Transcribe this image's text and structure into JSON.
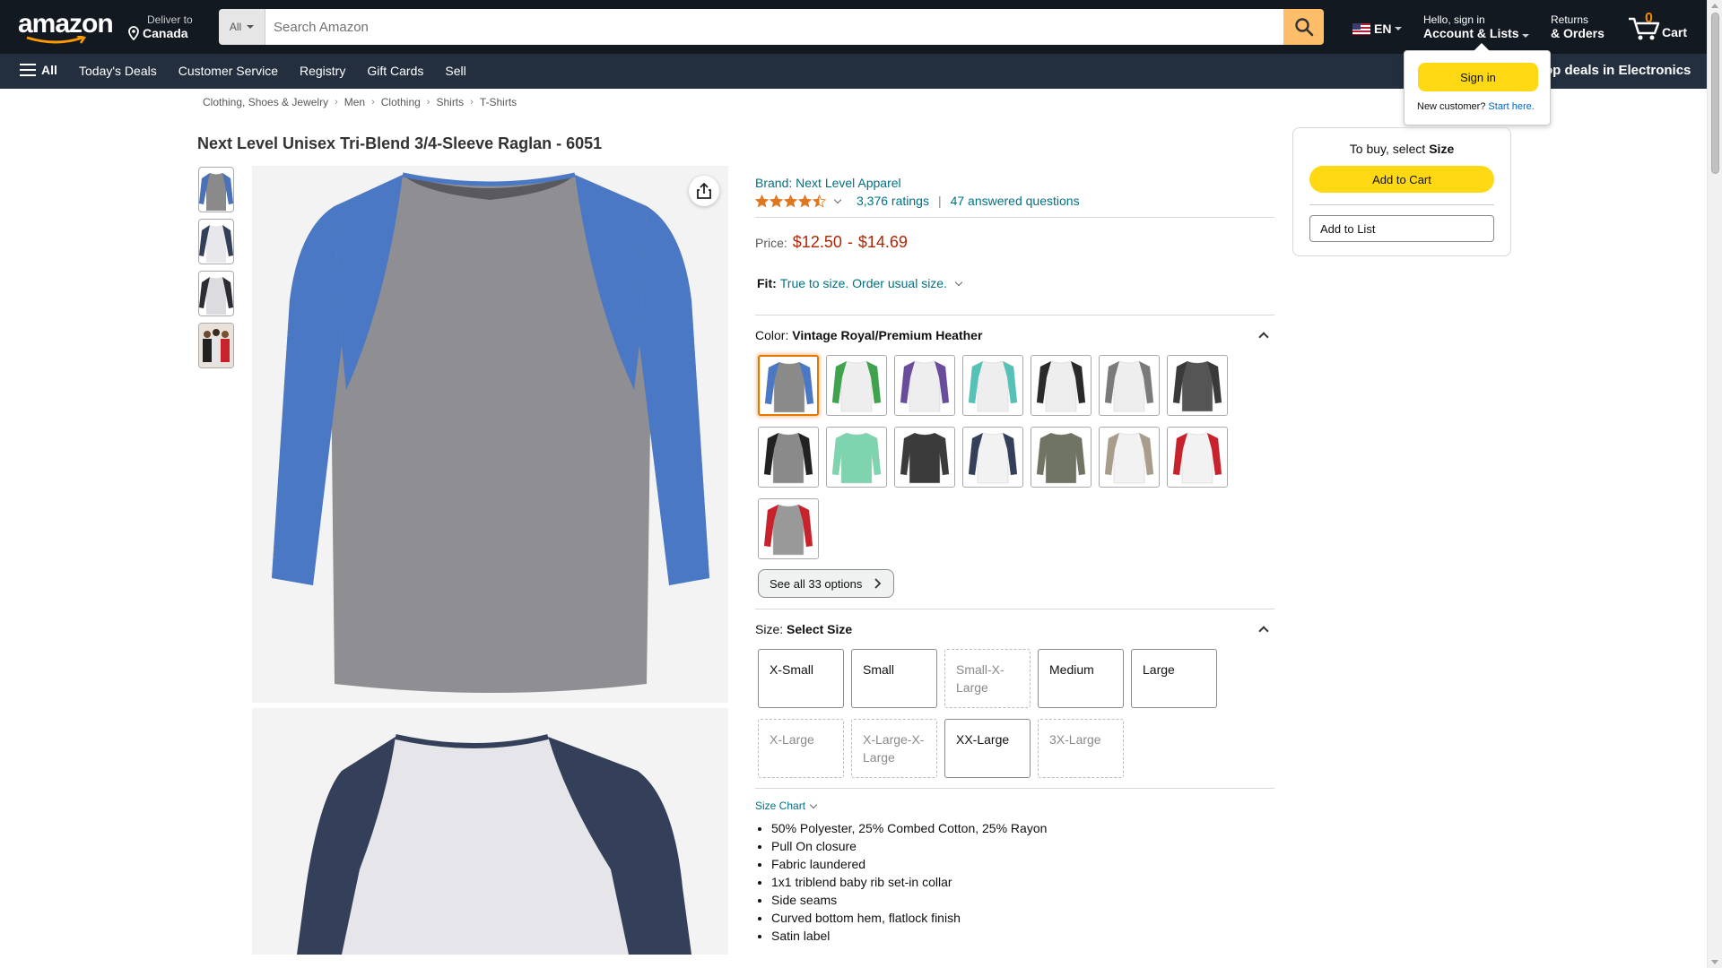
{
  "header": {
    "deliver_line1": "Deliver to",
    "deliver_line2": "Canada",
    "search_category": "All",
    "search_placeholder": "Search Amazon",
    "language": "EN",
    "account_line1": "Hello, sign in",
    "account_line2": "Account & Lists",
    "returns_line1": "Returns",
    "returns_line2": "& Orders",
    "cart_count": "0",
    "cart_label": "Cart"
  },
  "subnav": {
    "all_label": "All",
    "links": [
      "Today's Deals",
      "Customer Service",
      "Registry",
      "Gift Cards",
      "Sell"
    ],
    "promo": "op deals in Electronics"
  },
  "signin_flyout": {
    "button": "Sign in",
    "new_customer": "New customer?",
    "start_here": "Start here."
  },
  "breadcrumb": [
    "Clothing, Shoes & Jewelry",
    "Men",
    "Clothing",
    "Shirts",
    "T-Shirts"
  ],
  "product": {
    "title": "Next Level Unisex Tri-Blend 3/4-Sleeve Raglan - 6051",
    "brand": "Brand: Next Level Apparel",
    "rating_value": 4.5,
    "ratings_count": "3,376 ratings",
    "answered": "47 answered questions",
    "price_label": "Price:",
    "price_low": "$12.50",
    "price_sep": "-",
    "price_high": "$14.69",
    "fit_label": "Fit:",
    "fit_value": "True to size. Order usual size.",
    "color_label": "Color:",
    "color_value": "Vintage Royal/Premium Heather",
    "see_all": "See all 33 options",
    "size_label": "Size:",
    "size_value": "Select Size",
    "sizes": [
      {
        "label": "X-Small",
        "available": true
      },
      {
        "label": "Small",
        "available": true
      },
      {
        "label": "Small-X-Large",
        "available": false
      },
      {
        "label": "Medium",
        "available": true
      },
      {
        "label": "Large",
        "available": true
      },
      {
        "label": "X-Large",
        "available": false
      },
      {
        "label": "X-Large-X-Large",
        "available": false
      },
      {
        "label": "XX-Large",
        "available": true
      },
      {
        "label": "3X-Large",
        "available": false
      }
    ],
    "size_chart": "Size Chart",
    "bullets": [
      "50% Polyester, 25% Combed Cotton, 25% Rayon",
      "Pull On closure",
      "Fabric laundered",
      "1x1 triblend baby rib set-in collar",
      "Side seams",
      "Curved bottom hem, flatlock finish",
      "Satin label"
    ]
  },
  "buybox": {
    "prompt": "To buy, select",
    "prompt_bold": "Size",
    "add_to_cart": "Add to Cart",
    "add_to_list": "Add to List"
  },
  "colors": {
    "nav_dark": "#131921",
    "nav_sub": "#232f3e",
    "search_button": "#febd69",
    "cta_yellow": "#ffd814",
    "link": "#007185",
    "price_red": "#b12704",
    "selected_orange": "#e77600"
  }
}
